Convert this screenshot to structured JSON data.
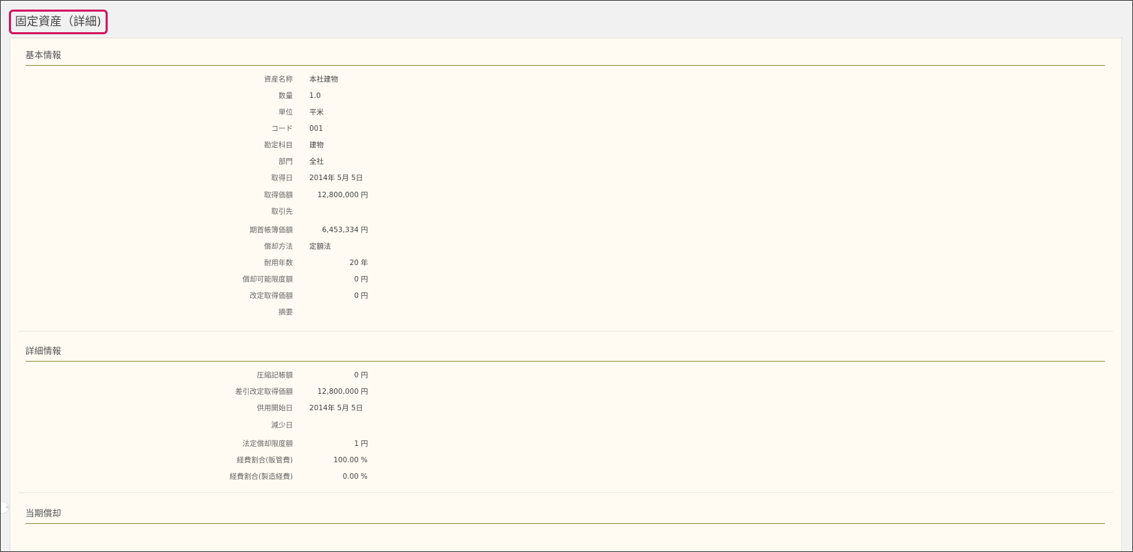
{
  "page": {
    "title": "固定資産（詳細)"
  },
  "sections": {
    "basic": {
      "title": "基本情報",
      "rows": [
        {
          "label": "資産名称",
          "value": "本社建物"
        },
        {
          "label": "数量",
          "value": "1.0"
        },
        {
          "label": "単位",
          "value": "平米"
        },
        {
          "label": "コード",
          "value": "001"
        },
        {
          "label": "勘定科目",
          "value": "建物"
        },
        {
          "label": "部門",
          "value": "全社"
        },
        {
          "label": "取得日",
          "value": "2014年 5月 5日"
        },
        {
          "label": "取得価額",
          "number": "12,800,000",
          "unit": "円"
        },
        {
          "label": "取引先",
          "value": ""
        },
        {
          "label": "期首帳簿価額",
          "number": "6,453,334",
          "unit": "円"
        },
        {
          "label": "償却方法",
          "value": "定額法"
        },
        {
          "label": "耐用年数",
          "number": "20",
          "unit": "年"
        },
        {
          "label": "償却可能限度額",
          "number": "0",
          "unit": "円"
        },
        {
          "label": "改定取得価額",
          "number": "0",
          "unit": "円"
        },
        {
          "label": "摘要",
          "value": ""
        }
      ]
    },
    "detail": {
      "title": "詳細情報",
      "rows": [
        {
          "label": "圧縮記帳額",
          "number": "0",
          "unit": "円"
        },
        {
          "label": "差引改定取得価額",
          "number": "12,800,000",
          "unit": "円"
        },
        {
          "label": "供用開始日",
          "value": "2014年 5月 5日"
        },
        {
          "label": "減少日",
          "value": ""
        },
        {
          "label": "法定償却限度額",
          "number": "1",
          "unit": "円"
        },
        {
          "label": "経費割合(販管費)",
          "number": "100.00",
          "unit": "%"
        },
        {
          "label": "経費割合(製造経費)",
          "number": "0.00",
          "unit": "%"
        }
      ]
    },
    "current": {
      "title": "当期償却"
    }
  },
  "colors": {
    "accent": "#d3115e",
    "rule": "#8b8b2f",
    "panel": "#fffbf2"
  }
}
